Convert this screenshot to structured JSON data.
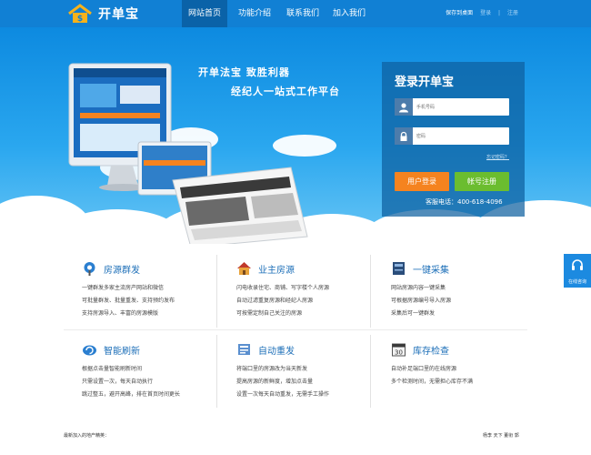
{
  "nav": {
    "logo_text": "开单宝",
    "tabs": [
      "网站首页",
      "功能介绍",
      "联系我们",
      "加入我们"
    ],
    "save_desktop": "保存到桌面",
    "login": "登录",
    "register": "注册",
    "sep": "|"
  },
  "hero": {
    "slogan1": "开单法宝  致胜利器",
    "slogan2": "经纪人一站式工作平台"
  },
  "login": {
    "title": "登录开单宝",
    "phone_placeholder": "手机号码",
    "password_placeholder": "密码",
    "forgot": "忘记密码？",
    "login_button": "用户登录",
    "register_button": "帐号注册",
    "service": "客服电话：400-618-4096"
  },
  "float": {
    "label": "在线咨询"
  },
  "features": [
    {
      "title": "房源群发",
      "icon": "broadcast-icon",
      "lines": [
        "一键群发多家主流房产网站和微信",
        "可批量群发、批量重发、支持预约发布",
        "支持房源导入、丰富的房源模版"
      ]
    },
    {
      "title": "业主房源",
      "icon": "house-icon",
      "lines": [
        "闪电收录住宅、商铺、写字楼个人房源",
        "自动过滤重复房源和经纪人房源",
        "可按需定制自己关注的房源"
      ]
    },
    {
      "title": "一键采集",
      "icon": "book-icon",
      "lines": [
        "网站房源内容一键采集",
        "可根据房源编号导入房源",
        "采集后可一键群发"
      ]
    },
    {
      "title": "智能刷新",
      "icon": "refresh-cloud-icon",
      "lines": [
        "根据点击量智能刷新时间",
        "只需设置一次，每天自动执行",
        "跳过整五，避开高峰，排在首页时间更长"
      ]
    },
    {
      "title": "自动重发",
      "icon": "repost-icon",
      "lines": [
        "将端口里的房源改为当天新发",
        "提高房源的新鲜度，增加点击量",
        "设置一次每天自动重发，无需手工操作"
      ]
    },
    {
      "title": "库存检查",
      "icon": "calendar-icon",
      "lines": [
        "自动补足端口里的在线房源",
        "多个检测时间，无需担心库存不满"
      ]
    }
  ],
  "footer": {
    "left": "最新加入的地产精英：",
    "right": "杨李 天下  董衔  郭"
  },
  "colors": {
    "nav": "#1180d4",
    "orange": "#f5831f",
    "green": "#6bbd2f",
    "title_blue": "#1d6fb8"
  }
}
